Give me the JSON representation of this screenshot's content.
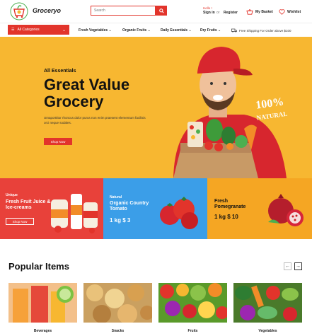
{
  "header": {
    "brand": "Groceryo",
    "search_placeholder": "Search",
    "hello": "Hello !",
    "signin": "Sign in",
    "or": "or",
    "register": "Register",
    "basket": "My Basket",
    "wishlist": "Wishlist"
  },
  "nav": {
    "categories_label": "All Categories",
    "items": [
      "Fresh Vegetables",
      "Organic Fruits",
      "Daily Essentials",
      "Dry Fruits"
    ],
    "shipping": "Free Shipping For Order above $100"
  },
  "hero": {
    "eyebrow": "All Essentials",
    "title": "Great Value Grocery",
    "description": "Umaporttitor rhoncus dolor purus non enim praesent elementum facilisis orci neque sodales.",
    "button": "Shop Now",
    "badge_top": "100%",
    "badge_bottom": "NATURAL"
  },
  "promos": [
    {
      "eyebrow": "Unique",
      "title": "Fresh Fruit Juice & Ice-creams",
      "button": "Shop Now"
    },
    {
      "eyebrow": "Natural",
      "title": "Organic Country Tomato",
      "price": "1 kg $ 3"
    },
    {
      "title": "Fresh Pomegranate",
      "price": "1 kg $ 10"
    }
  ],
  "popular": {
    "title": "Popular Items",
    "items": [
      "Beverages",
      "Snacks",
      "Fruits",
      "Vegetables"
    ]
  },
  "colors": {
    "accent": "#e2342b",
    "hero_bg": "#f7b731",
    "promo_red": "#e8413a",
    "promo_blue": "#3b9ee8",
    "promo_orange": "#f5a623"
  }
}
